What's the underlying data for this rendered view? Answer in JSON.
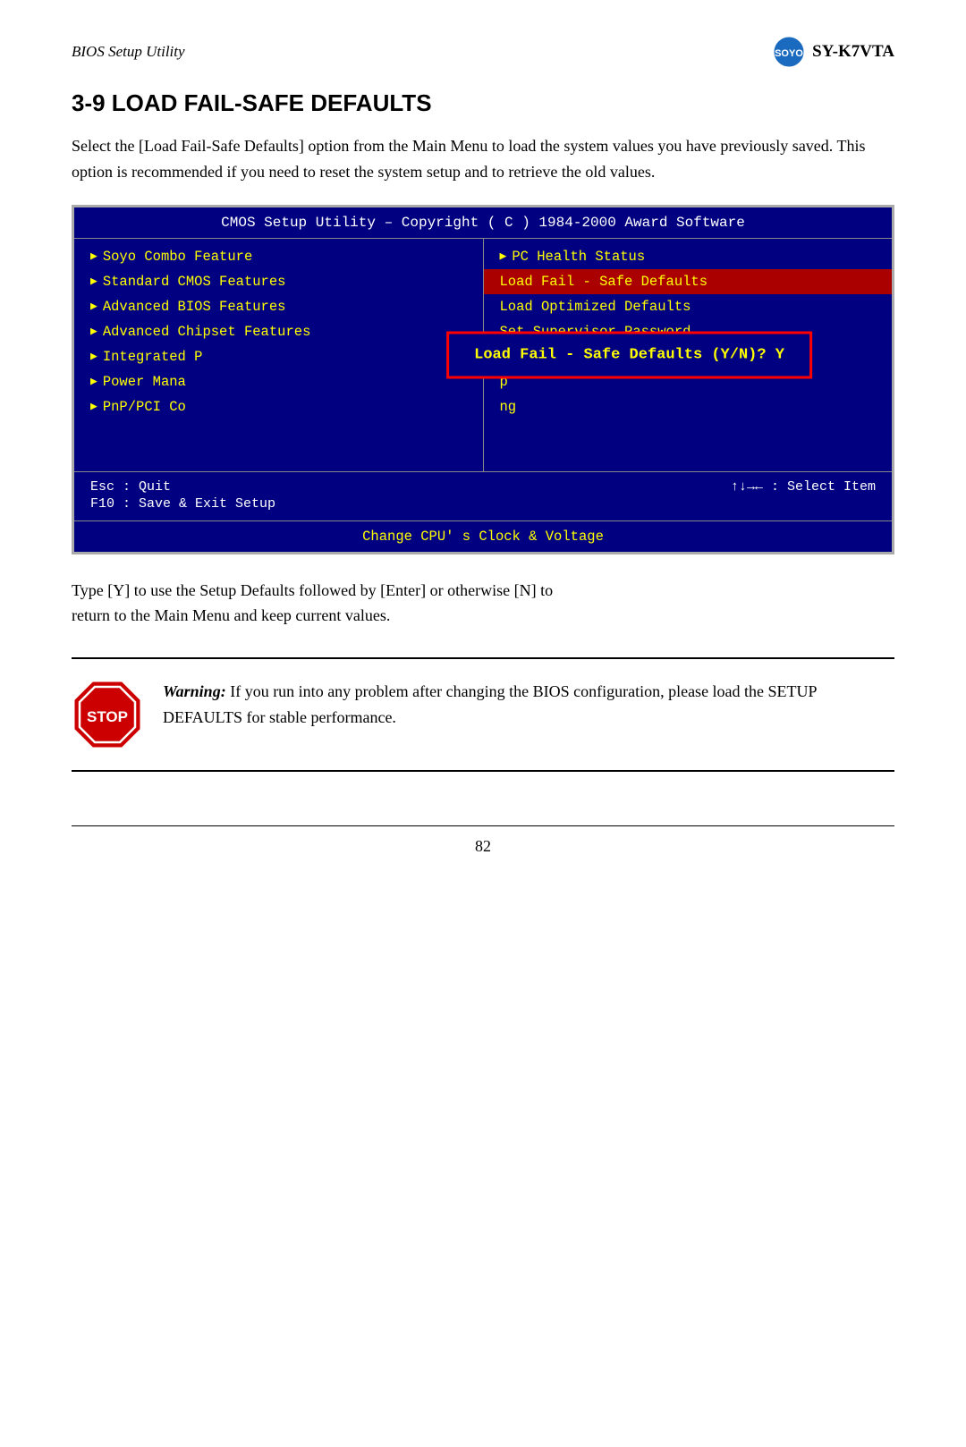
{
  "header": {
    "bios_label": "BIOS Setup Utility",
    "product_name": "SY-K7VTA"
  },
  "section": {
    "title": "3-9  LOAD FAIL-SAFE DEFAULTS",
    "intro": "Select the [Load Fail-Safe Defaults] option from the Main Menu to load the system values you have previously saved. This option is recommended if you need to reset the system setup and to retrieve the old values.",
    "outro_line1": "Type [Y] to use the Setup Defaults followed by [Enter] or otherwise [N] to",
    "outro_line2": "return to the Main Menu and keep current values."
  },
  "bios_screen": {
    "title": "CMOS Setup Utility – Copyright ( C ) 1984-2000 Award Software",
    "left_menu": [
      {
        "label": "Soyo Combo Feature",
        "has_arrow": true
      },
      {
        "label": "Standard CMOS Features",
        "has_arrow": true
      },
      {
        "label": "Advanced BIOS Features",
        "has_arrow": true
      },
      {
        "label": "Advanced Chipset Features",
        "has_arrow": true
      },
      {
        "label": "Integrated P…",
        "has_arrow": true,
        "truncated": true
      },
      {
        "label": "Power Mana…",
        "has_arrow": true,
        "truncated": true
      },
      {
        "label": "PnP/PCI Co…",
        "has_arrow": true,
        "truncated": true
      }
    ],
    "right_menu": [
      {
        "label": "PC Health Status",
        "has_arrow": true
      },
      {
        "label": "Load Fail - Safe Defaults",
        "highlighted": true
      },
      {
        "label": "Load Optimized Defaults"
      },
      {
        "label": "Set Supervisor Password"
      },
      {
        "label": "",
        "truncated": true
      },
      {
        "label": "…p",
        "truncated": true
      },
      {
        "label": "…ng",
        "truncated": true
      }
    ],
    "dialog_text": "Load Fail - Safe Defaults (Y/N)? Y",
    "footer": {
      "left1": "Esc : Quit",
      "right1": "↑↓→←   :   Select Item",
      "left2": "F10 : Save & Exit Setup"
    },
    "bottom_label": "Change CPU' s Clock & Voltage"
  },
  "warning": {
    "text_bold": "Warning:",
    "text": " If you run into any problem after changing the BIOS configuration, please load the SETUP DEFAULTS for stable performance."
  },
  "page_number": "82"
}
